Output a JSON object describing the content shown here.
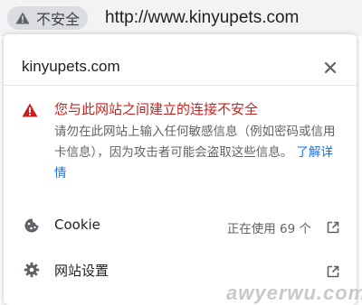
{
  "omnibox": {
    "security_chip": {
      "icon": "warning-triangle-icon",
      "label": "不安全"
    },
    "url": "http://www.kinyupets.com"
  },
  "popup": {
    "site": "kinyupets.com",
    "close_icon": "close-icon",
    "security": {
      "icon": "warning-triangle-icon",
      "color": "#c5221f",
      "headline": "您与此网站之间建立的连接不安全",
      "body": "请勿在此网站上输入任何敏感信息（例如密码或信用卡信息），因为攻击者可能会盗取这些信息。",
      "learn_more": "了解详情",
      "link_color": "#1a73e8"
    },
    "rows": [
      {
        "icon": "cookie-icon",
        "label": "Cookie",
        "value": "正在使用 69 个",
        "action_icon": "open-external-icon"
      },
      {
        "icon": "gear-icon",
        "label": "网站设置",
        "value": "",
        "action_icon": "open-external-icon"
      }
    ]
  },
  "watermark": "awyerwu.com"
}
